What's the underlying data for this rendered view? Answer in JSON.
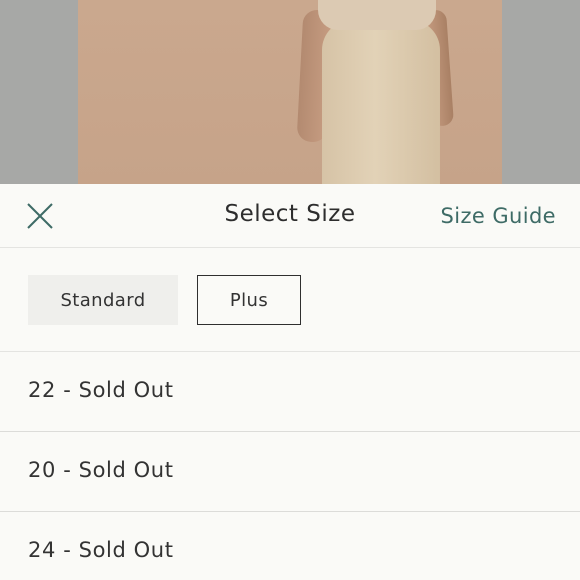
{
  "sheet": {
    "title": "Select Size",
    "size_guide_label": "Size Guide",
    "close_icon": "close-icon"
  },
  "fit_options": {
    "standard_label": "Standard",
    "plus_label": "Plus",
    "selected": "Plus"
  },
  "sizes": [
    {
      "label": "22 - Sold Out"
    },
    {
      "label": "20 - Sold Out"
    },
    {
      "label": "24 - Sold Out"
    }
  ],
  "colors": {
    "accent_link": "#3e6b66",
    "selected_border": "#2f2f2f",
    "unselected_fill": "#efefec"
  }
}
